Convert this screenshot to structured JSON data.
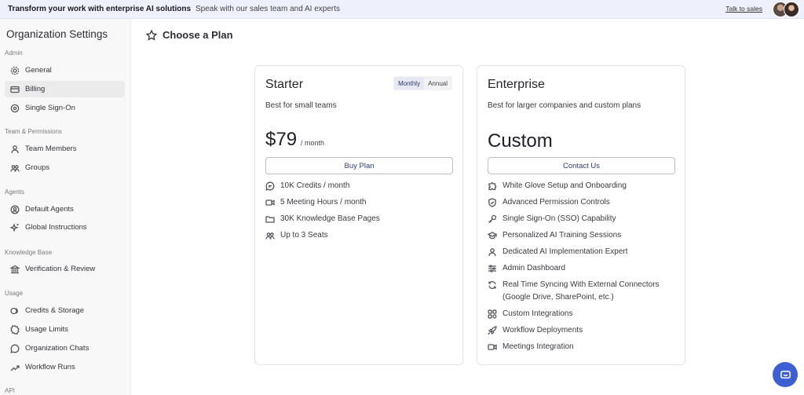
{
  "banner": {
    "headline": "Transform your work with enterprise AI solutions",
    "subtext": "Speak with our sales team and AI experts",
    "link": "Talk to sales"
  },
  "sidebar": {
    "title": "Organization Settings",
    "sections": {
      "admin": "Admin",
      "team": "Team & Permissions",
      "agents": "Agents",
      "kb": "Knowledge Base",
      "usage": "Usage",
      "api": "API"
    },
    "items": {
      "general": "General",
      "billing": "Billing",
      "sso": "Single Sign-On",
      "team_members": "Team Members",
      "groups": "Groups",
      "default_agents": "Default Agents",
      "global_instructions": "Global Instructions",
      "verification": "Verification & Review",
      "credits": "Credits & Storage",
      "usage_limits": "Usage Limits",
      "org_chats": "Organization Chats",
      "workflow_runs": "Workflow Runs"
    }
  },
  "main": {
    "title": "Choose a Plan"
  },
  "starter": {
    "name": "Starter",
    "toggle_monthly": "Monthly",
    "toggle_annual": "Annual",
    "description": "Best for small teams",
    "price": "$79",
    "price_unit": "/ month",
    "button": "Buy Plan",
    "features": [
      "10K Credits / month",
      "5 Meeting Hours / month",
      "30K Knowledge Base Pages",
      "Up to 3 Seats"
    ]
  },
  "enterprise": {
    "name": "Enterprise",
    "description": "Best for larger companies and custom plans",
    "price": "Custom",
    "button": "Contact Us",
    "features": [
      "White Glove Setup and Onboarding",
      "Advanced Permission Controls",
      "Single Sign-On (SSO) Capability",
      "Personalized AI Training Sessions",
      "Dedicated AI Implementation Expert",
      "Admin Dashboard",
      "Real Time Syncing With External Connectors (Google Drive, SharePoint, etc.)",
      "Custom Integrations",
      "Workflow Deployments",
      "Meetings Integration"
    ]
  },
  "colors": {
    "accent": "#3d5fd1",
    "banner_bg": "#eef1fb",
    "sidebar_bg": "#f8f8f8"
  }
}
